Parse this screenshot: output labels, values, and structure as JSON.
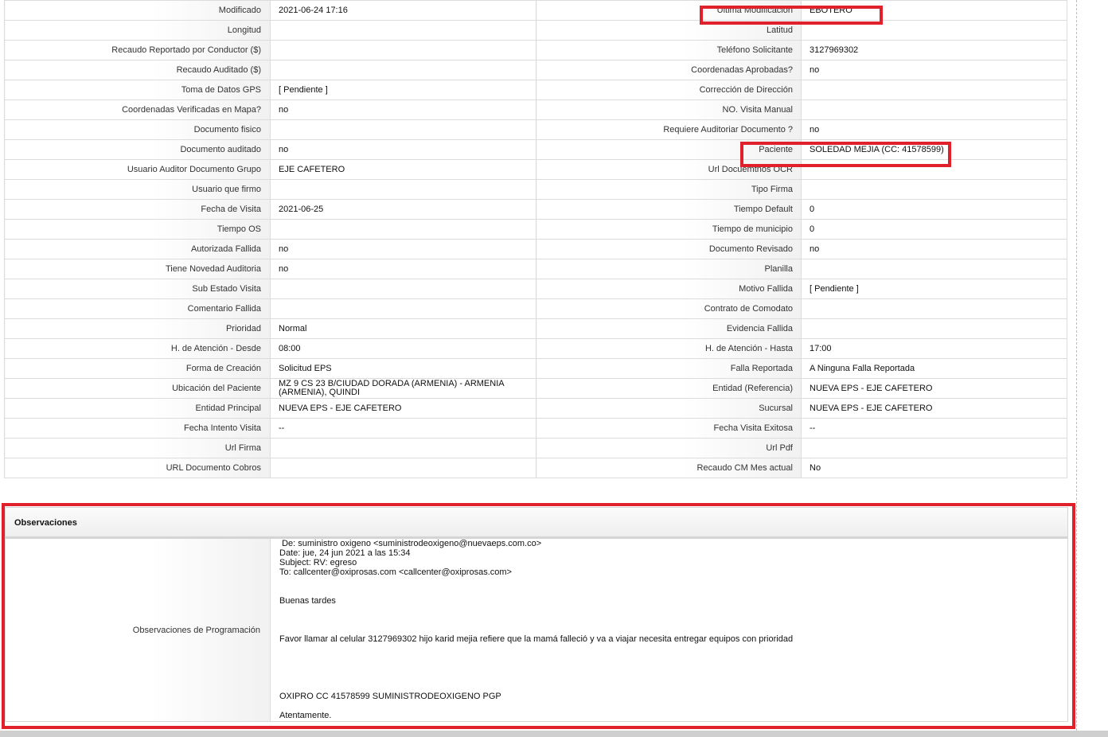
{
  "rows": [
    {
      "left_label": "Modificado",
      "left_value": "2021-06-24 17:16",
      "right_label": "Ultima Modificación",
      "right_value": "EBOTERO"
    },
    {
      "left_label": "Longitud",
      "left_value": "",
      "right_label": "Latitud",
      "right_value": ""
    },
    {
      "left_label": "Recaudo Reportado por Conductor ($)",
      "left_value": "",
      "right_label": "Teléfono Solicitante",
      "right_value": "3127969302"
    },
    {
      "left_label": "Recaudo Auditado ($)",
      "left_value": "",
      "right_label": "Coordenadas Aprobadas?",
      "right_value": " no"
    },
    {
      "left_label": "Toma de Datos GPS",
      "left_value": "[ Pendiente ]",
      "right_label": "Corrección de Dirección",
      "right_value": ""
    },
    {
      "left_label": "Coordenadas Verificadas en Mapa?",
      "left_value": " no",
      "right_label": "NO. Visita Manual",
      "right_value": ""
    },
    {
      "left_label": "Documento fisico",
      "left_value": "",
      "right_label": "Requiere Auditoriar Documento ?",
      "right_value": " no"
    },
    {
      "left_label": "Documento auditado",
      "left_value": " no",
      "right_label": "Paciente",
      "right_value": "SOLEDAD MEJIA (CC: 41578599)"
    },
    {
      "left_label": "Usuario Auditor Documento Grupo",
      "left_value": "EJE CAFETERO",
      "right_label": "Url Docuemtnos OCR",
      "right_value": ""
    },
    {
      "left_label": "Usuario que firmo",
      "left_value": "",
      "right_label": "Tipo Firma",
      "right_value": ""
    },
    {
      "left_label": "Fecha de Visita",
      "left_value": " 2021-06-25",
      "right_label": "Tiempo Default",
      "right_value": "0"
    },
    {
      "left_label": "Tiempo OS",
      "left_value": "",
      "right_label": "Tiempo de municipio",
      "right_value": "0"
    },
    {
      "left_label": "Autorizada Fallida",
      "left_value": "no",
      "right_label": "Documento Revisado",
      "right_value": " no"
    },
    {
      "left_label": "Tiene Novedad Auditoria",
      "left_value": "no",
      "right_label": "Planilla",
      "right_value": ""
    },
    {
      "left_label": "Sub Estado Visita",
      "left_value": "",
      "right_label": "Motivo Fallida",
      "right_value": "[ Pendiente ]"
    },
    {
      "left_label": "Comentario Fallida",
      "left_value": "",
      "right_label": "Contrato de Comodato",
      "right_value": ""
    },
    {
      "left_label": "Prioridad",
      "left_value": "Normal",
      "right_label": "Evidencia Fallida",
      "right_value": ""
    },
    {
      "left_label": "H. de Atención - Desde",
      "left_value": "08:00",
      "right_label": "H. de Atención - Hasta",
      "right_value": "17:00"
    },
    {
      "left_label": "Forma de Creación",
      "left_value": "Solicitud EPS",
      "right_label": "Falla Reportada",
      "right_value": "A Ninguna Falla Reportada"
    },
    {
      "left_label": "Ubicación del Paciente",
      "left_value": "MZ 9 CS 23 B/CIUDAD DORADA (ARMENIA) - ARMENIA (ARMENIA), QUINDI",
      "right_label": "Entidad (Referencia)",
      "right_value": "NUEVA EPS - EJE CAFETERO"
    },
    {
      "left_label": "Entidad Principal",
      "left_value": "NUEVA EPS - EJE CAFETERO",
      "right_label": "Sucursal",
      "right_value": "NUEVA EPS - EJE CAFETERO"
    },
    {
      "left_label": "Fecha Intento Visita",
      "left_value": " --",
      "right_label": "Fecha Visita Exitosa",
      "right_value": " --"
    },
    {
      "left_label": "Url Firma",
      "left_value": "",
      "right_label": "Url Pdf",
      "right_value": ""
    },
    {
      "left_label": "URL Documento Cobros",
      "left_value": "",
      "right_label": "Recaudo CM Mes actual",
      "right_value": "No"
    }
  ],
  "observations": {
    "title": "Observaciones",
    "label": "Observaciones de Programación",
    "text": " De: suministro oxigeno <suministrodeoxigeno@nuevaeps.com.co>\nDate: jue, 24 jun 2021 a las 15:34\nSubject: RV: egreso\nTo: callcenter@oxiprosas.com <callcenter@oxiprosas.com>\n\n\nBuenas tardes\n\n\n\nFavor llamar al celular 3127969302 hijo karid mejia refiere que la mamá falleció y va a viajar necesita entregar equipos con prioridad\n\n\n\n\n\nOXIPRO CC 41578599 SUMINISTRODEOXIGENO PGP\n\nAtentamente."
  },
  "colors": {
    "highlight": "#e0202a",
    "border": "#dcdcdc",
    "label_bg": "#f1f1f1"
  }
}
